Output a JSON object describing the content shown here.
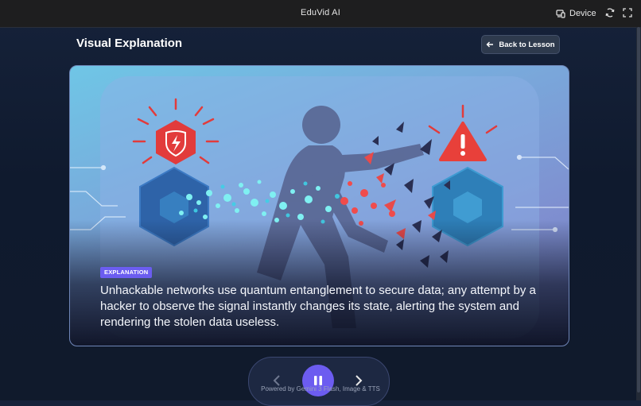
{
  "topbar": {
    "app_title": "EduVid AI",
    "device_label": "Device"
  },
  "page": {
    "title": "Visual Explanation",
    "back_label": "Back to Lesson"
  },
  "slide": {
    "badge": "EXPLANATION",
    "text": "Unhackable networks use quantum entanglement to secure data; any attempt by a hacker to observe the signal instantly changes its state, alerting the system and rendering the stolen data useless."
  },
  "player": {
    "state": "playing",
    "powered_by": "Powered by Gemini 3 Flash, Image & TTS"
  },
  "colors": {
    "accent": "#6c5cf0",
    "alert_red": "#e23b3b"
  }
}
